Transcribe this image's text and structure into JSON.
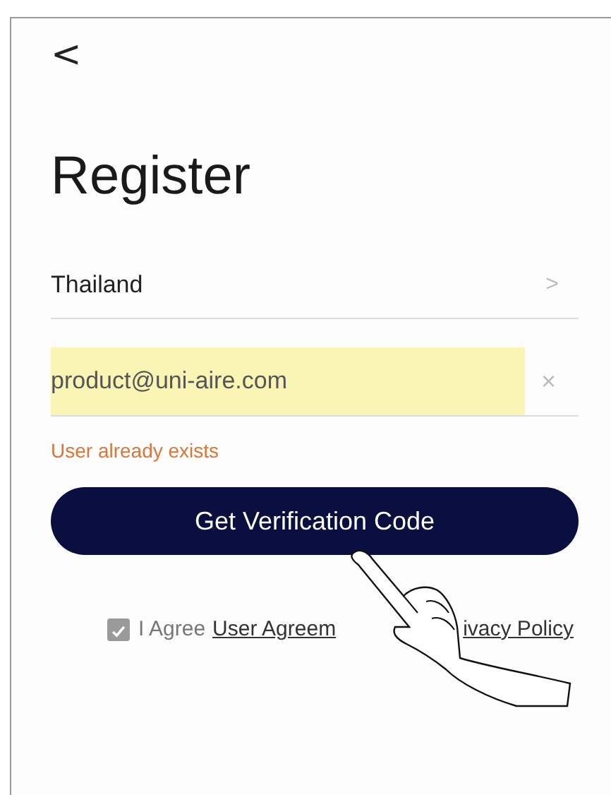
{
  "back": {
    "glyph": "<"
  },
  "title": "Register",
  "country": {
    "value": "Thailand",
    "chevron": ">"
  },
  "email": {
    "value": "product@uni-aire.com",
    "highlighted": true,
    "clear": "×"
  },
  "error": "User already exists",
  "button": "Get Verification Code",
  "agreement": {
    "checked": true,
    "prefix": "I Agree",
    "link_1": "User Agreem",
    "link_2": "ivacy Policy"
  }
}
